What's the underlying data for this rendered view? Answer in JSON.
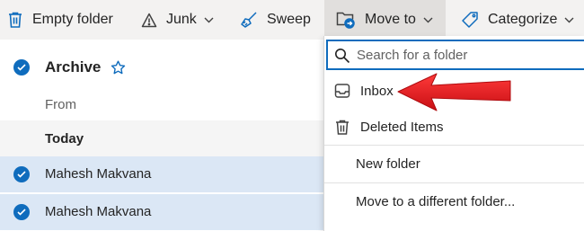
{
  "toolbar": {
    "empty_folder": "Empty folder",
    "junk": "Junk",
    "sweep": "Sweep",
    "move_to": "Move to",
    "categorize": "Categorize"
  },
  "list": {
    "folder_title": "Archive",
    "column_from": "From",
    "group_today": "Today",
    "messages": [
      {
        "sender": "Mahesh Makvana",
        "selected": true
      },
      {
        "sender": "Mahesh Makvana",
        "selected": true
      }
    ]
  },
  "move_menu": {
    "search_placeholder": "Search for a folder",
    "items": [
      {
        "label": "Inbox",
        "icon": "inbox-icon"
      },
      {
        "label": "Deleted Items",
        "icon": "trash-icon"
      },
      {
        "label": "New folder"
      },
      {
        "label": "Move to a different folder..."
      }
    ]
  },
  "colors": {
    "accent": "#0f6cbd",
    "selected_row": "#dbe7f5",
    "toolbar_bg": "#f3f2f1",
    "annotation_arrow": "#e8161b"
  }
}
